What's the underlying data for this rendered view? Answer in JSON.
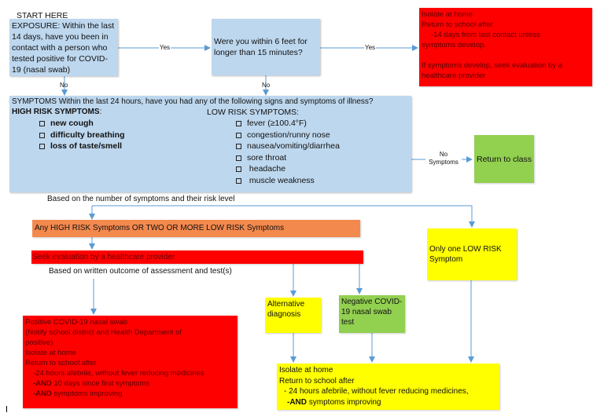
{
  "start_label": "START HERE",
  "exposure": {
    "text": "EXPOSURE: Within the last 14 days, have you been in contact with a person who tested positive for COVID-19 (nasal swab)",
    "yes_label": "Yes",
    "no_label": "No"
  },
  "proximity": {
    "text": "Were you within 6 feet for longer than 15 minutes?",
    "yes_label": "Yes",
    "no_label": "No"
  },
  "isolate_contact": {
    "lines": [
      "Isolate at home",
      "Return to school after",
      "-14 days from last contact unless",
      "symptoms develop.",
      "",
      "If symptoms develop, seek evaluation by a",
      "healthcare provider"
    ],
    "color": "#ff0000"
  },
  "symptoms": {
    "header": "SYMPTOMS Within the last 24 hours, have you had any of the following signs and symptoms of illness?",
    "high_risk_title": "HIGH RISK SYMPTOMS",
    "high_risk_colon": ":",
    "high_risk": [
      "new cough",
      "difficulty breathing",
      "loss of taste/smell"
    ],
    "low_risk_title": "LOW RISK SYMPTOMS:",
    "low_risk": [
      "fever (≥100.4°F)",
      "congestion/runny nose",
      "nausea/vomiting/diarrhea",
      "sore throat",
      " headache",
      " muscle weakness"
    ],
    "no_symptoms_label_1": "No",
    "no_symptoms_label_2": "Symptoms"
  },
  "return_to_class": {
    "text": "Return to class",
    "color": "#92d050"
  },
  "based_on_symptoms": "Based on the number of symptoms and their risk level",
  "any_high_risk": {
    "text": "Any HIGH RISK Symptoms OR TWO OR MORE LOW RISK Symptoms",
    "color": "#f4894e"
  },
  "seek_evaluation": {
    "text": "Seek evaluation by a healthcare provider",
    "color": "#ff0000"
  },
  "based_on_outcome": "Based on written outcome of assessment and test(s)",
  "one_low_risk": {
    "text": "Only one LOW RISK Symptom",
    "color": "#ffff00"
  },
  "alternative": {
    "text": "Alternative diagnosis",
    "color": "#ffff00"
  },
  "negative": {
    "text": "Negative COVID-19 nasal swab test",
    "color": "#92d050"
  },
  "positive": {
    "lines": [
      "Positive COVID-19 nasal swab",
      "(Notify school district and Health Department of",
      "positive)",
      "Isolate at home",
      "Return to school after"
    ],
    "item1": "-24 hours afebrile, without fever reducing medicines",
    "item2_bold": "-AND",
    "item2_rest": " 10 days since first symptoms",
    "item3_bold": "-AND",
    "item3_rest": " symptoms improving",
    "color": "#ff0000"
  },
  "isolate_yellow": {
    "line1": "Isolate at home",
    "line2": "Return to school after",
    "item1": "- 24 hours afebrile, without fever reducing medicines,",
    "item2_bold": "-AND",
    "item2_rest": " symptoms improving",
    "color": "#ffff00"
  },
  "connector_color": "#5b9bd5"
}
